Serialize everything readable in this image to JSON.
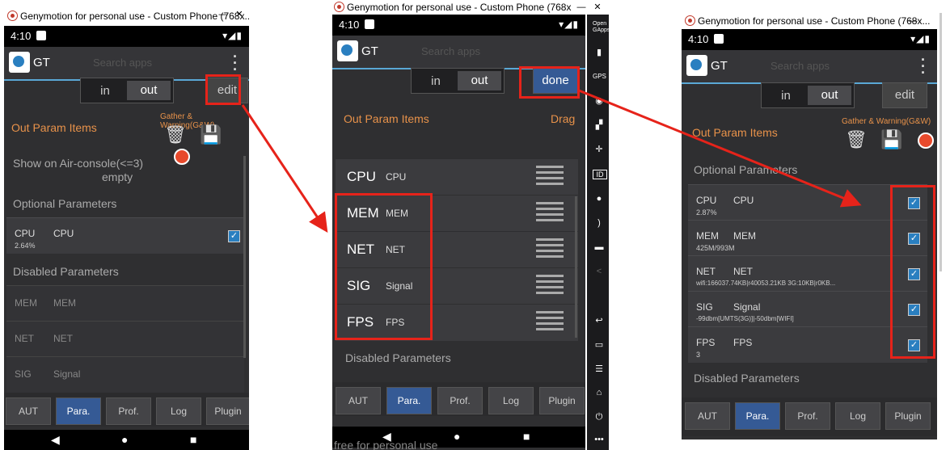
{
  "window_title": "Genymotion for personal use - Custom Phone (768x...",
  "window_title_short": "Genymotion for personal use - Custom Phone (768x",
  "status_time": "4:10",
  "app_title": "GT",
  "search_ghost": "Search apps",
  "toggle": {
    "in_label": "in",
    "out_label": "out"
  },
  "edit_label": "edit",
  "done_label": "done",
  "out_param_items": "Out Param Items",
  "drag_label": "Drag",
  "gather_warning": "Gather & Warning(G&W)",
  "show_on_air": "Show on Air-console(<=3)",
  "empty_label": "empty",
  "optional_params": "Optional Parameters",
  "disabled_params": "Disabled Parameters",
  "check_mark": "✓",
  "left_cpu": {
    "key": "CPU",
    "name": "CPU",
    "value": "2.64%"
  },
  "left_disabled": [
    {
      "key": "MEM",
      "name": "MEM"
    },
    {
      "key": "NET",
      "name": "NET"
    },
    {
      "key": "SIG",
      "name": "Signal"
    }
  ],
  "middle_items": [
    {
      "key": "CPU",
      "name": "CPU"
    },
    {
      "key": "MEM",
      "name": "MEM"
    },
    {
      "key": "NET",
      "name": "NET"
    },
    {
      "key": "SIG",
      "name": "Signal"
    },
    {
      "key": "FPS",
      "name": "FPS"
    }
  ],
  "right_items": [
    {
      "key": "CPU",
      "name": "CPU",
      "value": "2.87%"
    },
    {
      "key": "MEM",
      "name": "MEM",
      "value": "425M/993M"
    },
    {
      "key": "NET",
      "name": "NET",
      "value": "wifi:166037.74KB|r40053.21KB  3G:10KB|r0KB..."
    },
    {
      "key": "SIG",
      "name": "Signal",
      "value": "-99dbm[UMTS(3G)]|-50dbm[WIFI]"
    },
    {
      "key": "FPS",
      "name": "FPS",
      "value": "3"
    }
  ],
  "tabs": [
    "AUT",
    "Para.",
    "Prof.",
    "Log",
    "Plugin"
  ],
  "active_tab": "Para.",
  "footer_ghost": "free for personal use",
  "sidebar_labels": {
    "opengapps": "Open GApps",
    "gps": "GPS",
    "id": "ID"
  },
  "accent_colors": {
    "highlight": "#e6231a",
    "active_tab": "#355a95",
    "section_header": "#e8924a"
  }
}
